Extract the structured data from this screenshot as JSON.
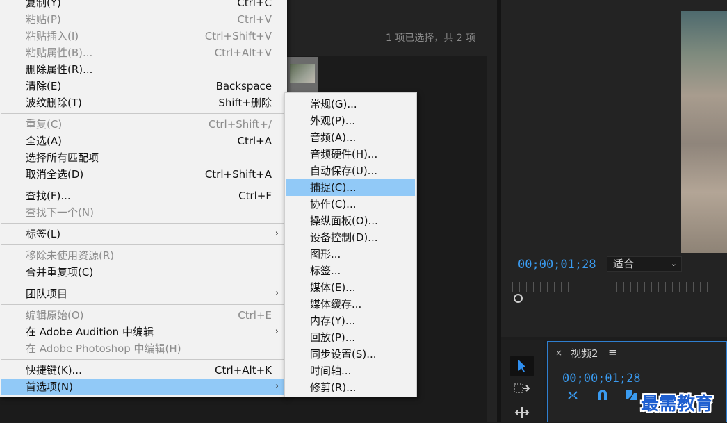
{
  "project": {
    "selection_status": "1 项已选择，共 2 项"
  },
  "monitor": {
    "timecode": "00;00;01;28",
    "fit_value": "适合"
  },
  "sequence": {
    "close": "×",
    "title": "视频2",
    "menu": "≡",
    "timecode": "00;00;01;28"
  },
  "watermark": "最需教育",
  "edit_menu": {
    "items": [
      {
        "label": "复制(Y)",
        "shortcut": "Ctrl+C",
        "disabled": false
      },
      {
        "label": "粘贴(P)",
        "shortcut": "Ctrl+V",
        "disabled": true
      },
      {
        "label": "粘贴插入(I)",
        "shortcut": "Ctrl+Shift+V",
        "disabled": true
      },
      {
        "label": "粘贴属性(B)...",
        "shortcut": "Ctrl+Alt+V",
        "disabled": true
      },
      {
        "label": "删除属性(R)...",
        "shortcut": "",
        "disabled": false
      },
      {
        "label": "清除(E)",
        "shortcut": "Backspace",
        "disabled": false
      },
      {
        "label": "波纹删除(T)",
        "shortcut": "Shift+删除",
        "disabled": false
      },
      {
        "label": "重复(C)",
        "shortcut": "Ctrl+Shift+/",
        "disabled": true
      },
      {
        "label": "全选(A)",
        "shortcut": "Ctrl+A",
        "disabled": false
      },
      {
        "label": "选择所有匹配项",
        "shortcut": "",
        "disabled": false
      },
      {
        "label": "取消全选(D)",
        "shortcut": "Ctrl+Shift+A",
        "disabled": false
      },
      {
        "label": "查找(F)...",
        "shortcut": "Ctrl+F",
        "disabled": false
      },
      {
        "label": "查找下一个(N)",
        "shortcut": "",
        "disabled": true
      },
      {
        "label": "标签(L)",
        "shortcut": "",
        "disabled": false,
        "submenu": true
      },
      {
        "label": "移除未使用资源(R)",
        "shortcut": "",
        "disabled": true
      },
      {
        "label": "合并重复项(C)",
        "shortcut": "",
        "disabled": false
      },
      {
        "label": "团队项目",
        "shortcut": "",
        "disabled": false,
        "submenu": true
      },
      {
        "label": "编辑原始(O)",
        "shortcut": "Ctrl+E",
        "disabled": true
      },
      {
        "label": "在 Adobe Audition 中编辑",
        "shortcut": "",
        "disabled": false,
        "submenu": true
      },
      {
        "label": "在 Adobe Photoshop 中编辑(H)",
        "shortcut": "",
        "disabled": true
      },
      {
        "label": "快捷键(K)...",
        "shortcut": "Ctrl+Alt+K",
        "disabled": false
      },
      {
        "label": "首选项(N)",
        "shortcut": "",
        "disabled": false,
        "submenu": true,
        "highlighted": true
      }
    ]
  },
  "preferences_submenu": {
    "items": [
      {
        "label": "常规(G)..."
      },
      {
        "label": "外观(P)..."
      },
      {
        "label": "音频(A)..."
      },
      {
        "label": "音频硬件(H)..."
      },
      {
        "label": "自动保存(U)..."
      },
      {
        "label": "捕捉(C)...",
        "highlighted": true
      },
      {
        "label": "协作(C)..."
      },
      {
        "label": "操纵面板(O)..."
      },
      {
        "label": "设备控制(D)..."
      },
      {
        "label": "图形..."
      },
      {
        "label": "标签..."
      },
      {
        "label": "媒体(E)..."
      },
      {
        "label": "媒体缓存..."
      },
      {
        "label": "内存(Y)..."
      },
      {
        "label": "回放(P)..."
      },
      {
        "label": "同步设置(S)..."
      },
      {
        "label": "时间轴..."
      },
      {
        "label": "修剪(R)..."
      }
    ]
  }
}
